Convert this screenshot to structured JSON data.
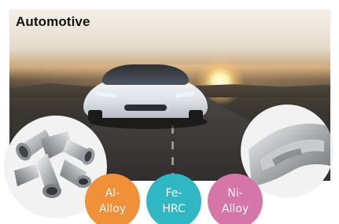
{
  "hero": {
    "title": "Automotive",
    "scene": "car-on-road-sunset"
  },
  "parts": {
    "left_icon": "aluminium-pipe-fittings-icon",
    "right_icon": "steel-stamped-part-icon"
  },
  "badges": [
    {
      "line1": "Al-",
      "line2": "Alloy",
      "color": "#f0913a"
    },
    {
      "line1": "Fe-",
      "line2": "HRC",
      "color": "#2fb8c3"
    },
    {
      "line1": "Ni-",
      "line2": "Alloy",
      "color": "#d676a8"
    }
  ]
}
